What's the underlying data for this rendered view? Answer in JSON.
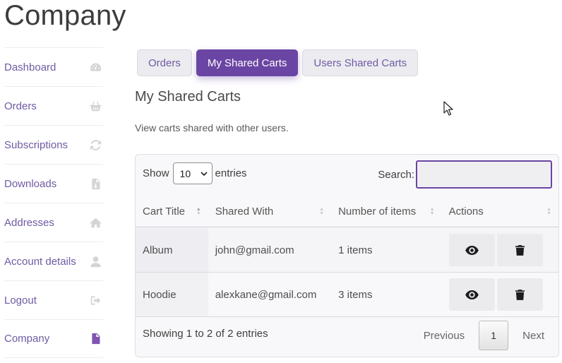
{
  "page_title": "Company",
  "sidebar": {
    "items": [
      {
        "label": "Dashboard",
        "icon": "dashboard-icon",
        "active": false
      },
      {
        "label": "Orders",
        "icon": "basket-icon",
        "active": false
      },
      {
        "label": "Subscriptions",
        "icon": "refresh-icon",
        "active": false
      },
      {
        "label": "Downloads",
        "icon": "file-download-icon",
        "active": false
      },
      {
        "label": "Addresses",
        "icon": "home-icon",
        "active": false
      },
      {
        "label": "Account details",
        "icon": "user-icon",
        "active": false
      },
      {
        "label": "Logout",
        "icon": "sign-out-icon",
        "active": false
      },
      {
        "label": "Company",
        "icon": "document-icon",
        "active": true
      }
    ]
  },
  "tabs": [
    {
      "label": "Orders",
      "active": false
    },
    {
      "label": "My Shared Carts",
      "active": true
    },
    {
      "label": "Users Shared Carts",
      "active": false
    }
  ],
  "section": {
    "title": "My Shared Carts",
    "description": "View carts shared with other users."
  },
  "table": {
    "show_label": "Show",
    "entries_label": "entries",
    "length_value": "10",
    "search_label": "Search:",
    "search_value": "",
    "columns": [
      "Cart Title",
      "Shared With",
      "Number of items",
      "Actions"
    ],
    "rows": [
      {
        "title": "Album",
        "shared_with": "john@gmail.com",
        "items": "1 items"
      },
      {
        "title": "Hoodie",
        "shared_with": "alexkane@gmail.com",
        "items": "3 items"
      }
    ],
    "info": "Showing 1 to 2 of 2 entries",
    "pagination": {
      "previous": "Previous",
      "page": "1",
      "next": "Next"
    }
  },
  "colors": {
    "accent": "#6b45a4",
    "link": "#6f5ba3",
    "active_icon": "#7f54b3"
  }
}
